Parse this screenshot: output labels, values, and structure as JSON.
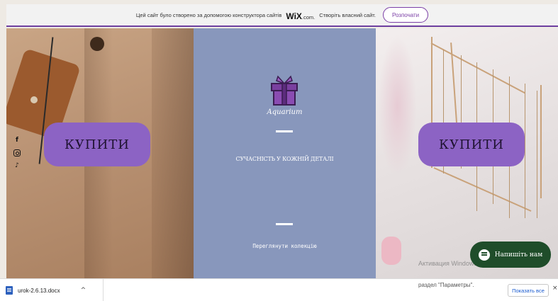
{
  "banner": {
    "text": "Цей сайт було створено за допомогою конструктора сайтів",
    "logo": "WiX",
    "logo_suffix": ".com.",
    "cta_text": "Створіть власний сайт.",
    "button_label": "Розпочати"
  },
  "left_panel": {
    "buy_label": "КУПИТИ",
    "social": {
      "facebook": "f",
      "tiktok": "♪"
    }
  },
  "center_panel": {
    "brand": "Aquarium",
    "tagline": "СУЧАСНІСТЬ У КОЖНІЙ ДЕТАЛІ",
    "link_label": "Переглянути колекцію"
  },
  "right_panel": {
    "buy_label": "КУПИТИ",
    "watermark": "Активация Windows"
  },
  "chat": {
    "label": "Напишіть нам"
  },
  "download_bar": {
    "file_name": "urok-2.6.13.docx",
    "caret": "^",
    "windows_hint": "раздел \"Параметры\".",
    "show_all_label": "Показать все",
    "close": "×"
  },
  "colors": {
    "accent_purple": "#8c63c4",
    "banner_purple": "#7b3fa6",
    "center_blue": "#8897bc",
    "chat_green": "#1f4d2a"
  }
}
